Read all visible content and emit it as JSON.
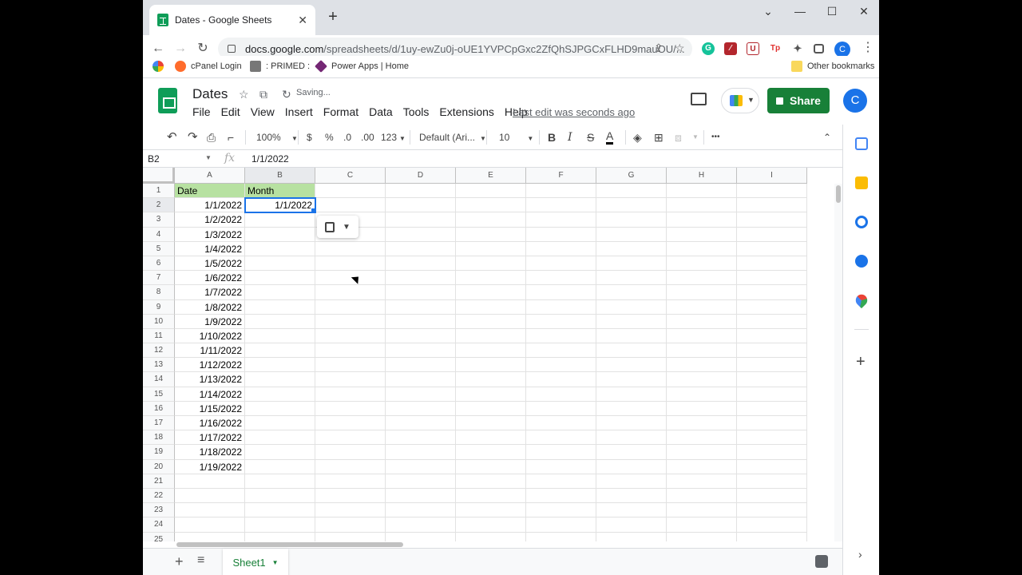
{
  "browser": {
    "tab_title": "Dates - Google Sheets",
    "url_host": "docs.google.com",
    "url_path": "/spreadsheets/d/1uy-ewZu0j-oUE1YVPCpGxc2ZfQhSJPGCxFLHD9mauOU/...",
    "profile_initial": "C"
  },
  "bookmarks": {
    "cpanel": "cPanel Login",
    "primed": ": PRIMED :",
    "powerapps": "Power Apps | Home",
    "other": "Other bookmarks"
  },
  "doc": {
    "title": "Dates",
    "status": "Saving...",
    "last_edit": "Last edit was seconds ago",
    "share_label": "Share",
    "avatar_initial": "C"
  },
  "menu": [
    "File",
    "Edit",
    "View",
    "Insert",
    "Format",
    "Data",
    "Tools",
    "Extensions",
    "Help"
  ],
  "toolbar": {
    "zoom": "100%",
    "currency": "$",
    "percent": "%",
    "dec_decrease": ".0",
    "dec_increase": ".00",
    "format_more": "123",
    "font": "Default (Ari...",
    "font_size": "10",
    "bold": "B",
    "italic": "I",
    "strike": "S",
    "text_color": "A",
    "more": "•••"
  },
  "formula_bar": {
    "cell_ref": "B2",
    "fx": "fx",
    "value": "1/1/2022"
  },
  "grid": {
    "columns": [
      "A",
      "B",
      "C",
      "D",
      "E",
      "F",
      "G",
      "H",
      "I"
    ],
    "header_row": [
      "Date",
      "Month"
    ],
    "col_a": [
      "1/1/2022",
      "1/2/2022",
      "1/3/2022",
      "1/4/2022",
      "1/5/2022",
      "1/6/2022",
      "1/7/2022",
      "1/8/2022",
      "1/9/2022",
      "1/10/2022",
      "1/11/2022",
      "1/12/2022",
      "1/13/2022",
      "1/14/2022",
      "1/15/2022",
      "1/16/2022",
      "1/17/2022",
      "1/18/2022",
      "1/19/2022"
    ],
    "b2": "1/1/2022",
    "row_numbers": [
      "1",
      "2",
      "3",
      "4",
      "5",
      "6",
      "7",
      "8",
      "9",
      "10",
      "11",
      "12",
      "13",
      "14",
      "15",
      "16",
      "17",
      "18",
      "19",
      "20",
      "21",
      "22",
      "23",
      "24",
      "25"
    ]
  },
  "sheets": {
    "active": "Sheet1"
  },
  "colors": {
    "header_fill": "#b7e1a1",
    "selection": "#1a73e8",
    "share_button": "#188038"
  }
}
